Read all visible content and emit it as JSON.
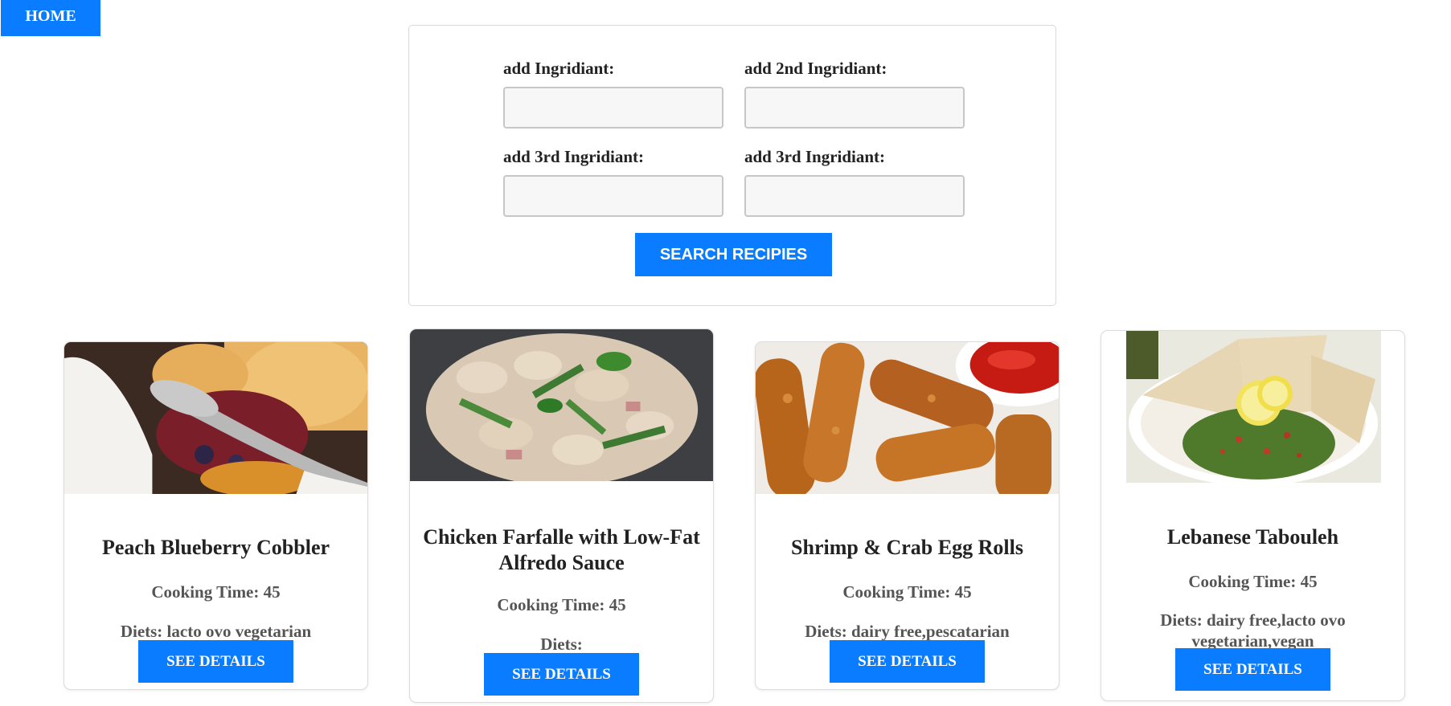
{
  "nav": {
    "home_label": "HOME"
  },
  "search": {
    "fields": [
      {
        "label": "add Ingridiant:",
        "value": "",
        "placeholder": ""
      },
      {
        "label": "add 2nd Ingridiant:",
        "value": "",
        "placeholder": ""
      },
      {
        "label": "add 3rd Ingridiant:",
        "value": "",
        "placeholder": ""
      },
      {
        "label": "add 3rd Ingridiant:",
        "value": "",
        "placeholder": ""
      }
    ],
    "button_label": "SEARCH RECIPIES"
  },
  "recipes": [
    {
      "title": "Peach Blueberry Cobbler",
      "cooking_time": "Cooking Time: 45",
      "diets": "Diets: lacto ovo vegetarian",
      "button_label": "SEE DETAILS",
      "image_icon": "cobbler-photo"
    },
    {
      "title": "Chicken Farfalle with Low-Fat Alfredo Sauce",
      "cooking_time": "Cooking Time: 45",
      "diets": "Diets:",
      "button_label": "SEE DETAILS",
      "image_icon": "pasta-photo"
    },
    {
      "title": "Shrimp & Crab Egg Rolls",
      "cooking_time": "Cooking Time: 45",
      "diets": "Diets: dairy free,pescatarian",
      "button_label": "SEE DETAILS",
      "image_icon": "egg-rolls-photo"
    },
    {
      "title": "Lebanese Tabouleh",
      "cooking_time": "Cooking Time: 45",
      "diets": "Diets: dairy free,lacto ovo vegetarian,vegan",
      "button_label": "SEE DETAILS",
      "image_icon": "tabouleh-photo"
    }
  ],
  "colors": {
    "accent": "#0a7cff",
    "input_bg": "#f7f7f7",
    "border": "#dcdcdc"
  }
}
